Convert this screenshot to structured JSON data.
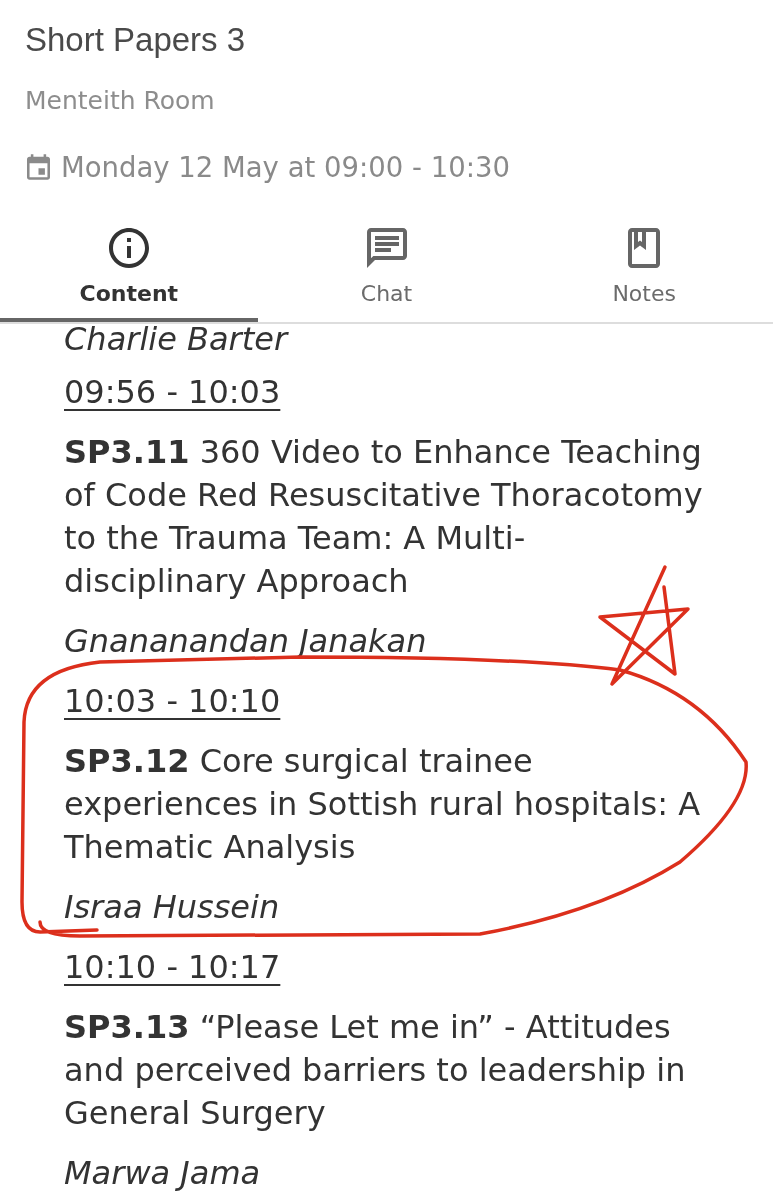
{
  "session": {
    "title": "Short Papers 3",
    "room": "Menteith Room",
    "schedule": "Monday 12 May at 09:00 - 10:30"
  },
  "tabs": [
    {
      "kind": "content",
      "label": "Content",
      "selected": true
    },
    {
      "kind": "chat",
      "label": "Chat",
      "selected": false
    },
    {
      "kind": "notes",
      "label": "Notes",
      "selected": false
    }
  ],
  "papers": [
    {
      "author": "Charlie Barter",
      "circled": false
    },
    {
      "time": "09:56 - 10:03",
      "title": "**SP3.11** 360 Video to Enhance Teaching of Code Red Resuscitative Thoracotomy to the Trauma Team: A Multi-disciplinary Approach",
      "author": "Gnananandan Janakan",
      "circled": false
    },
    {
      "time": "10:03 - 10:10",
      "title": "**SP3.12** Core surgical trainee experiences in Sottish rural hospitals: A Thematic Analysis",
      "author": "Israa Hussein",
      "circled": true
    },
    {
      "time": "10:10 - 10:17",
      "title": "**SP3.13** “Please Let me in” - Attitudes and perceived barriers to leadership in General Surgery",
      "author": "Marwa Jama",
      "circled": false
    }
  ],
  "doodles": {
    "star": true
  }
}
